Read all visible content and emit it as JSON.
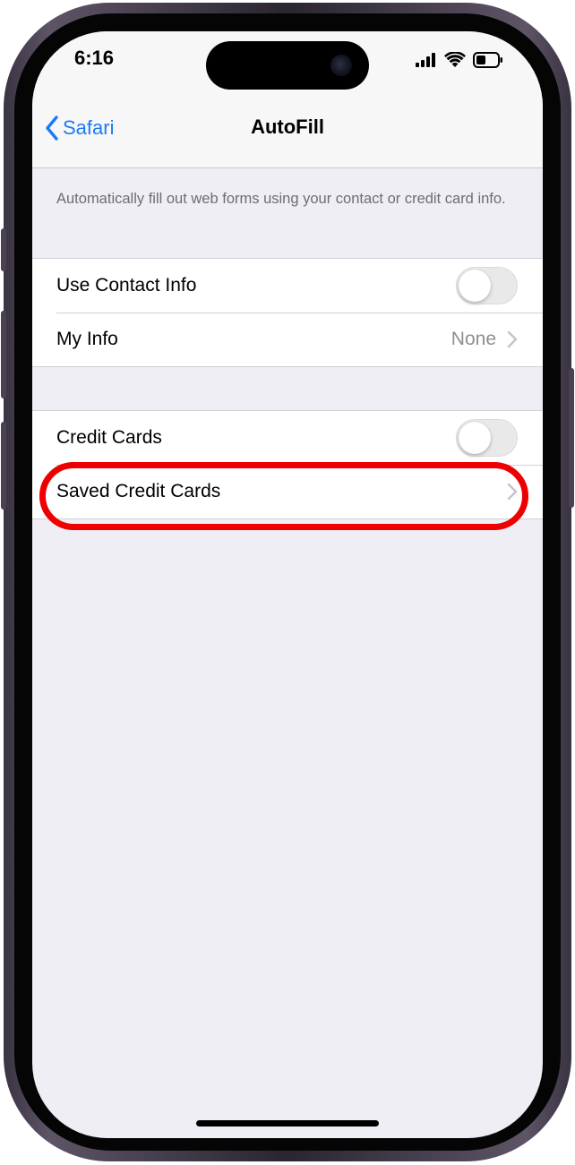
{
  "status_bar": {
    "time": "6:16",
    "icons": [
      "cellular-signal-icon",
      "wifi-icon",
      "battery-icon"
    ]
  },
  "nav": {
    "back_label": "Safari",
    "title": "AutoFill"
  },
  "description": "Automatically fill out web forms using your contact or credit card info.",
  "contact_group": {
    "use_contact_info": {
      "label": "Use Contact Info",
      "enabled": false
    },
    "my_info": {
      "label": "My Info",
      "value": "None"
    }
  },
  "card_group": {
    "credit_cards": {
      "label": "Credit Cards",
      "enabled": false
    },
    "saved_credit_cards": {
      "label": "Saved Credit Cards"
    }
  },
  "colors": {
    "accent": "#1a7cf5",
    "background": "#efeef4",
    "highlight": "#ee0000"
  }
}
